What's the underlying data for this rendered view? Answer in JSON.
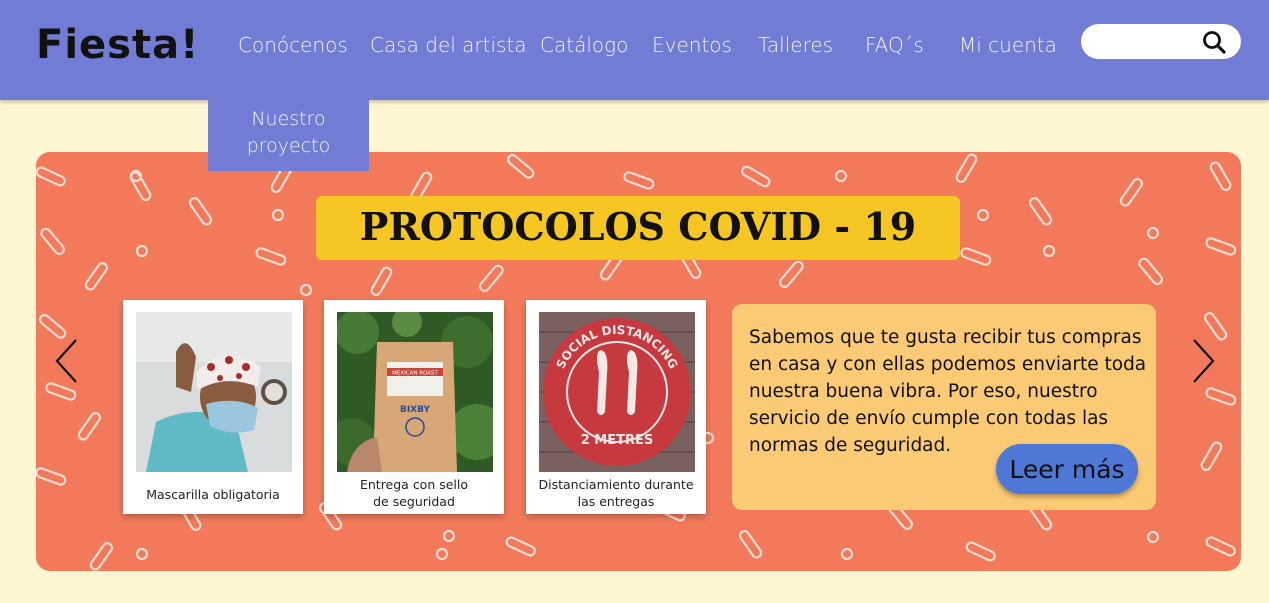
{
  "header": {
    "logo": "Fiesta!",
    "nav": [
      "Conócenos",
      "Casa del artista",
      "Catálogo",
      "Eventos",
      "Talleres",
      "FAQ´s",
      "Mi cuenta"
    ],
    "search": {
      "value": "",
      "icon": "search-icon"
    }
  },
  "dropdown": {
    "label": "Nuestro proyecto",
    "line1": "Nuestro",
    "line2": "proyecto"
  },
  "banner": {
    "title": "PROTOCOLOS COVID - 19",
    "cards": [
      {
        "caption": "Mascarilla obligatoria",
        "line1": "Mascarilla obligatoria",
        "line2": ""
      },
      {
        "caption": "Entrega con sello de seguridad",
        "line1": "Entrega con sello",
        "line2": "de seguridad",
        "bag_brand": "BIXBY",
        "bag_label": "MEXICAN ROAST"
      },
      {
        "caption": "Distanciamiento durante las entregas",
        "line1": "Distanciamiento durante",
        "line2": "las entregas",
        "sticker_top": "SOCIAL DISTANCING",
        "sticker_bottom": "2 METRES"
      }
    ],
    "info_text": "Sabemos que te gusta recibir tus compras en casa y con ellas podemos enviarte toda nuestra buena vibra. Por eso, nuestro servicio de envío cumple con todas las normas de seguridad.",
    "read_more": "Leer más",
    "prev_icon": "chevron-left-icon",
    "next_icon": "chevron-right-icon"
  },
  "colors": {
    "header": "#737cd4",
    "page_bg": "#fdf6d3",
    "banner": "#f27a5a",
    "title_bg": "#f6c623",
    "info_bg": "#fbca74",
    "button": "#4f77d6"
  }
}
